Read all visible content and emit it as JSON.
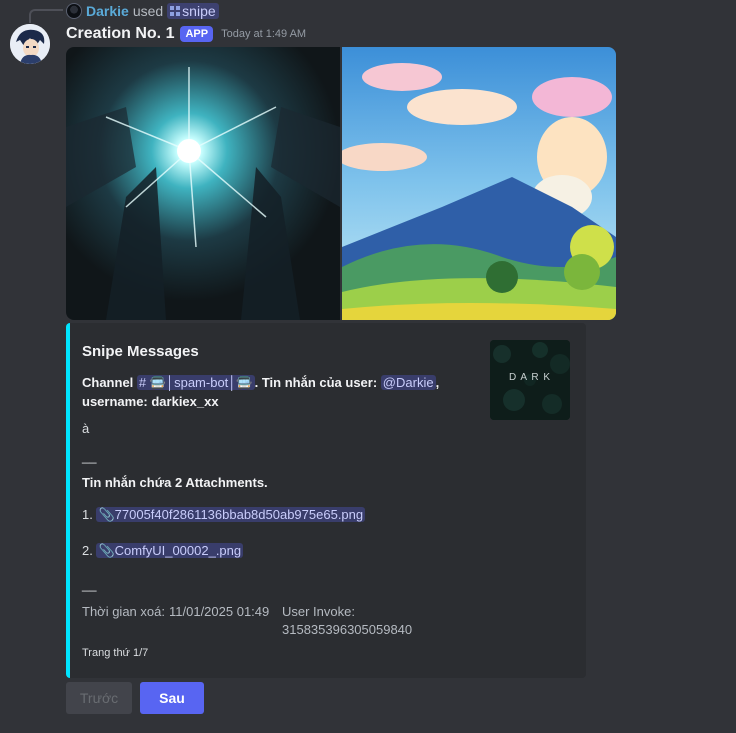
{
  "reply": {
    "username": "Darkie",
    "used_text": "used",
    "command": "snipe"
  },
  "message": {
    "author": "Creation No. 1",
    "badge": "APP",
    "timestamp": "Today at 1:49 AM"
  },
  "embed": {
    "accent_color": "#00e5ff",
    "title": "Snipe Messages",
    "channel_label": "Channel",
    "channel_name": "│spam-bot│",
    "channel_emoji": "🚍",
    "tin_nhan_label": ". Tin nhắn của user:",
    "user_mention": "@Darkie",
    "comma": ",",
    "username_line": "username: darkiex_xx",
    "message_content": "à",
    "separator1": "__",
    "attachments_heading": "Tin nhắn chứa 2 Attachments.",
    "attachments": [
      {
        "index": "1.",
        "filename": "77005f40f2861136bbab8d50ab975e65.png"
      },
      {
        "index": "2.",
        "filename": "ComfyUI_00002_.png"
      }
    ],
    "separator2": "__",
    "fields": [
      {
        "name": "Thời gian xoá:",
        "value": "11/01/2025 01:49"
      },
      {
        "name": "User Invoke:",
        "value": "315835396305059840"
      }
    ],
    "thumbnail_text": "D A R K",
    "footer": "Trang thứ 1/7"
  },
  "buttons": {
    "prev": "Trước",
    "next": "Sau"
  },
  "colors": {
    "background": "#313338",
    "embed_bg": "#2b2d31",
    "blurple": "#5865f2"
  }
}
